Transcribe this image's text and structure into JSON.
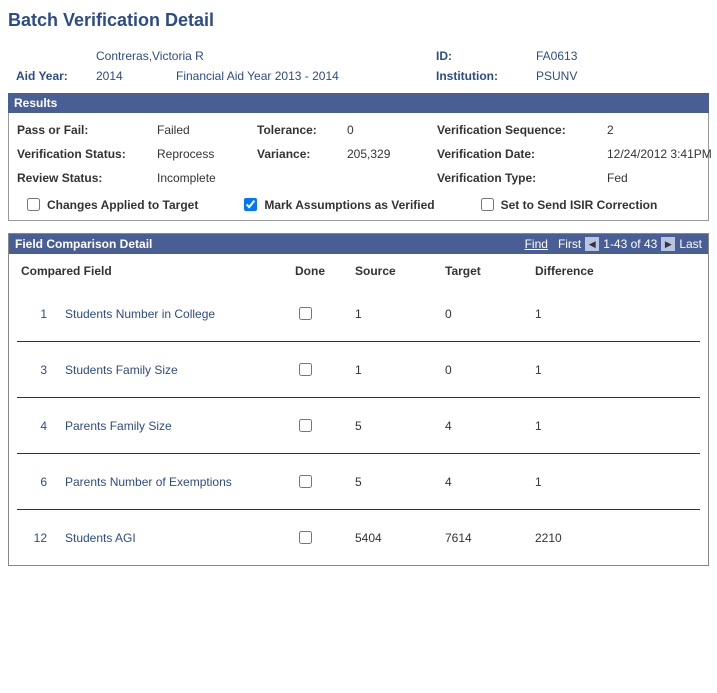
{
  "page": {
    "title": "Batch Verification Detail"
  },
  "header": {
    "name_label": "",
    "name": "Contreras,Victoria R",
    "aid_year_label": "Aid Year:",
    "aid_year": "2014",
    "fa_year_desc": "Financial Aid Year 2013 - 2014",
    "id_label": "ID:",
    "id": "FA0613",
    "institution_label": "Institution:",
    "institution": "PSUNV"
  },
  "results_bar": "Results",
  "results": {
    "pass_fail_label": "Pass or Fail:",
    "pass_fail": "Failed",
    "tolerance_label": "Tolerance:",
    "tolerance": "0",
    "verif_seq_label": "Verification Sequence:",
    "verif_seq": "2",
    "verif_status_label": "Verification Status:",
    "verif_status": "Reprocess",
    "variance_label": "Variance:",
    "variance": "205,329",
    "verif_date_label": "Verification Date:",
    "verif_date": "12/24/2012  3:41PM",
    "review_status_label": "Review Status:",
    "review_status": "Incomplete",
    "verif_type_label": "Verification Type:",
    "verif_type": "Fed"
  },
  "checks": {
    "changes_applied": "Changes Applied to Target",
    "mark_assumptions": "Mark Assumptions as Verified",
    "send_isir": "Set to Send ISIR Correction"
  },
  "detail_bar": {
    "title": "Field Comparison Detail",
    "find": "Find",
    "first": "First",
    "range": "1-43 of 43",
    "last": "Last"
  },
  "columns": {
    "compared": "Compared Field",
    "done": "Done",
    "source": "Source",
    "target": "Target",
    "difference": "Difference"
  },
  "rows": [
    {
      "num": "1",
      "field": "Students Number in College",
      "source": "1",
      "target": "0",
      "difference": "1"
    },
    {
      "num": "3",
      "field": "Students Family Size",
      "source": "1",
      "target": "0",
      "difference": "1"
    },
    {
      "num": "4",
      "field": "Parents Family Size",
      "source": "5",
      "target": "4",
      "difference": "1"
    },
    {
      "num": "6",
      "field": "Parents Number of Exemptions",
      "source": "5",
      "target": "4",
      "difference": "1"
    },
    {
      "num": "12",
      "field": "Students AGI",
      "source": "5404",
      "target": "7614",
      "difference": "2210"
    }
  ]
}
